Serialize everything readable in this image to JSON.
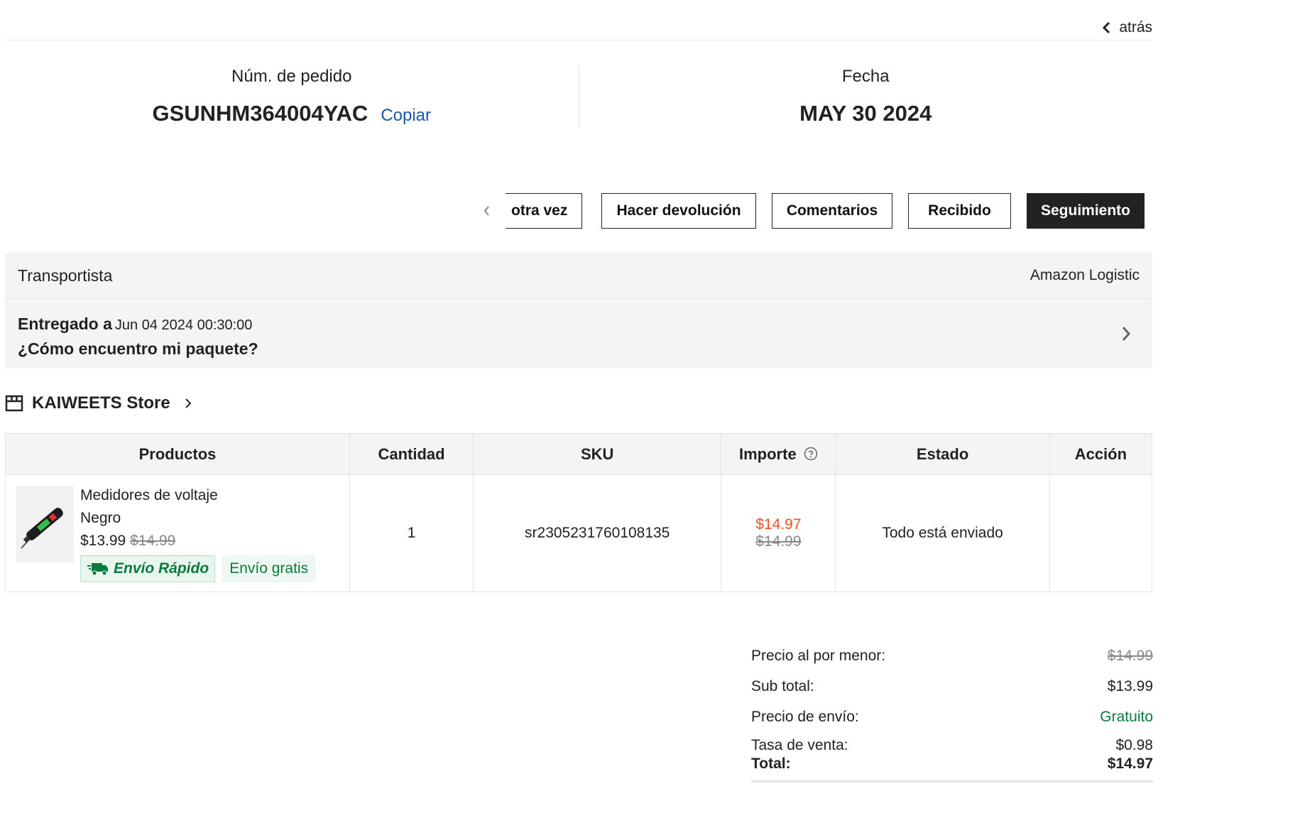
{
  "nav": {
    "back_label": "atrás"
  },
  "order": {
    "number_label": "Núm. de pedido",
    "number_value": "GSUNHM364004YAC",
    "copy_label": "Copiar",
    "date_label": "Fecha",
    "date_value": "MAY 30 2024"
  },
  "actions": {
    "buttons": [
      {
        "label": "otra vez"
      },
      {
        "label": "Hacer devolución"
      },
      {
        "label": "Comentarios"
      },
      {
        "label": "Recibido"
      },
      {
        "label": "Seguimiento"
      }
    ]
  },
  "carrier": {
    "label": "Transportista",
    "value": "Amazon Logistic",
    "delivered_label": "Entregado a",
    "delivered_datetime": "Jun 04 2024 00:30:00",
    "help_link": "¿Cómo encuentro mi paquete?"
  },
  "store": {
    "name": "KAIWEETS Store"
  },
  "table": {
    "headers": {
      "products": "Productos",
      "quantity": "Cantidad",
      "sku": "SKU",
      "amount": "Importe",
      "status": "Estado",
      "action": "Acción"
    },
    "rows": [
      {
        "product_name": "Medidores de voltaje",
        "variant": "Negro",
        "price": "$13.99",
        "original_price": "$14.99",
        "tag_fast": "Envío Rápido",
        "tag_free": "Envío gratis",
        "quantity": "1",
        "sku": "sr2305231760108135",
        "amount": "$14.97",
        "amount_original": "$14.99",
        "status": "Todo está enviado",
        "action": ""
      }
    ]
  },
  "summary": {
    "retail_label": "Precio al por menor:",
    "retail_value": "$14.99",
    "subtotal_label": "Sub total:",
    "subtotal_value": "$13.99",
    "shipping_label": "Precio de envío:",
    "shipping_value": "Gratuito",
    "tax_label": "Tasa de venta:",
    "tax_value": "$0.98",
    "total_label": "Total:",
    "total_value": "$14.97"
  },
  "colors": {
    "accent_link": "#1a5aa6",
    "price_red": "#f0501e",
    "green": "#0a7a3d",
    "dark_button": "#222222"
  }
}
